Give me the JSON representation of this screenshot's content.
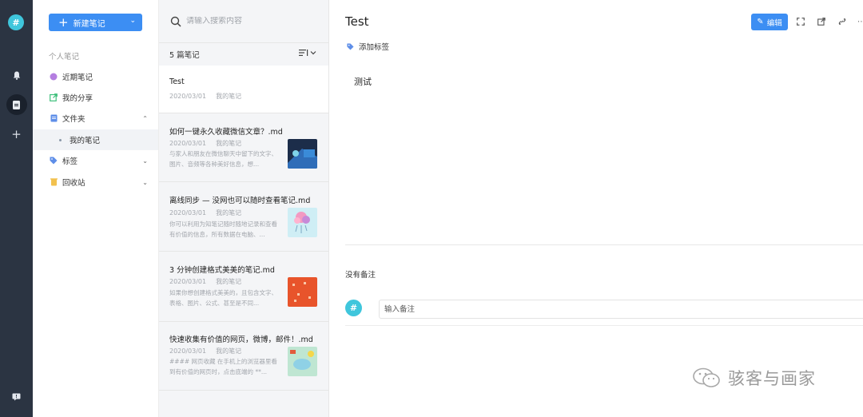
{
  "rail": {
    "logo": "#",
    "items": [
      {
        "icon": "bell-icon"
      },
      {
        "icon": "notes-icon"
      },
      {
        "icon": "plus-icon"
      }
    ],
    "bottom_icon": "feedback-icon"
  },
  "sidebar": {
    "new_button_label": "新建笔记",
    "section_label": "个人笔记",
    "items": [
      {
        "label": "近期笔记",
        "icon": "clock-icon",
        "color": "#b47ee0"
      },
      {
        "label": "我的分享",
        "icon": "share-icon",
        "color": "#3cbf7a"
      },
      {
        "label": "文件夹",
        "icon": "folder-icon",
        "color": "#5e8ee8"
      },
      {
        "label": "我的笔记",
        "icon": "bullet-icon"
      },
      {
        "label": "标签",
        "icon": "tag-icon",
        "color": "#5e8ee8"
      },
      {
        "label": "回收站",
        "icon": "trash-icon",
        "color": "#f2c14e"
      }
    ]
  },
  "notes_list": {
    "search_placeholder": "请输入搜索内容",
    "count_label": "5 篇笔记",
    "notes": [
      {
        "title": "Test",
        "date": "2020/03/01",
        "folder": "我的笔记",
        "excerpt": ""
      },
      {
        "title": "如何一键永久收藏微信文章？.md",
        "date": "2020/03/01",
        "folder": "我的笔记",
        "excerpt": "与家人和朋友在微信聊天中留下的文字、图片、音频等各种美好信息，想..."
      },
      {
        "title": "离线同步 — 没网也可以随时查看笔记.md",
        "date": "2020/03/01",
        "folder": "我的笔记",
        "excerpt": "你可以利用为知笔记随时随地记录和查看有价值的信息，所有数据在电脑、..."
      },
      {
        "title": "3 分钟创建格式美美的笔记.md",
        "date": "2020/03/01",
        "folder": "我的笔记",
        "excerpt": "如果你想创建格式美美的，且包含文字、表格、图片、公式、甚至是不同..."
      },
      {
        "title": "快速收集有价值的网页，微博，邮件！.md",
        "date": "2020/03/01",
        "folder": "我的笔记",
        "excerpt": "#### 网页收藏 在手机上的浏览器里看到有价值的网页时，点击底端的 **..."
      }
    ]
  },
  "editor": {
    "title": "Test",
    "edit_label": "编辑",
    "add_tag_label": "添加标签",
    "content": "测试",
    "no_comment_label": "没有备注",
    "comment_avatar": "#",
    "comment_placeholder": "输入备注"
  },
  "watermark": "骇客与画家",
  "colors": {
    "primary": "#3c8ef3",
    "rail_bg": "#2b3442",
    "logo": "#3fc6dc"
  }
}
